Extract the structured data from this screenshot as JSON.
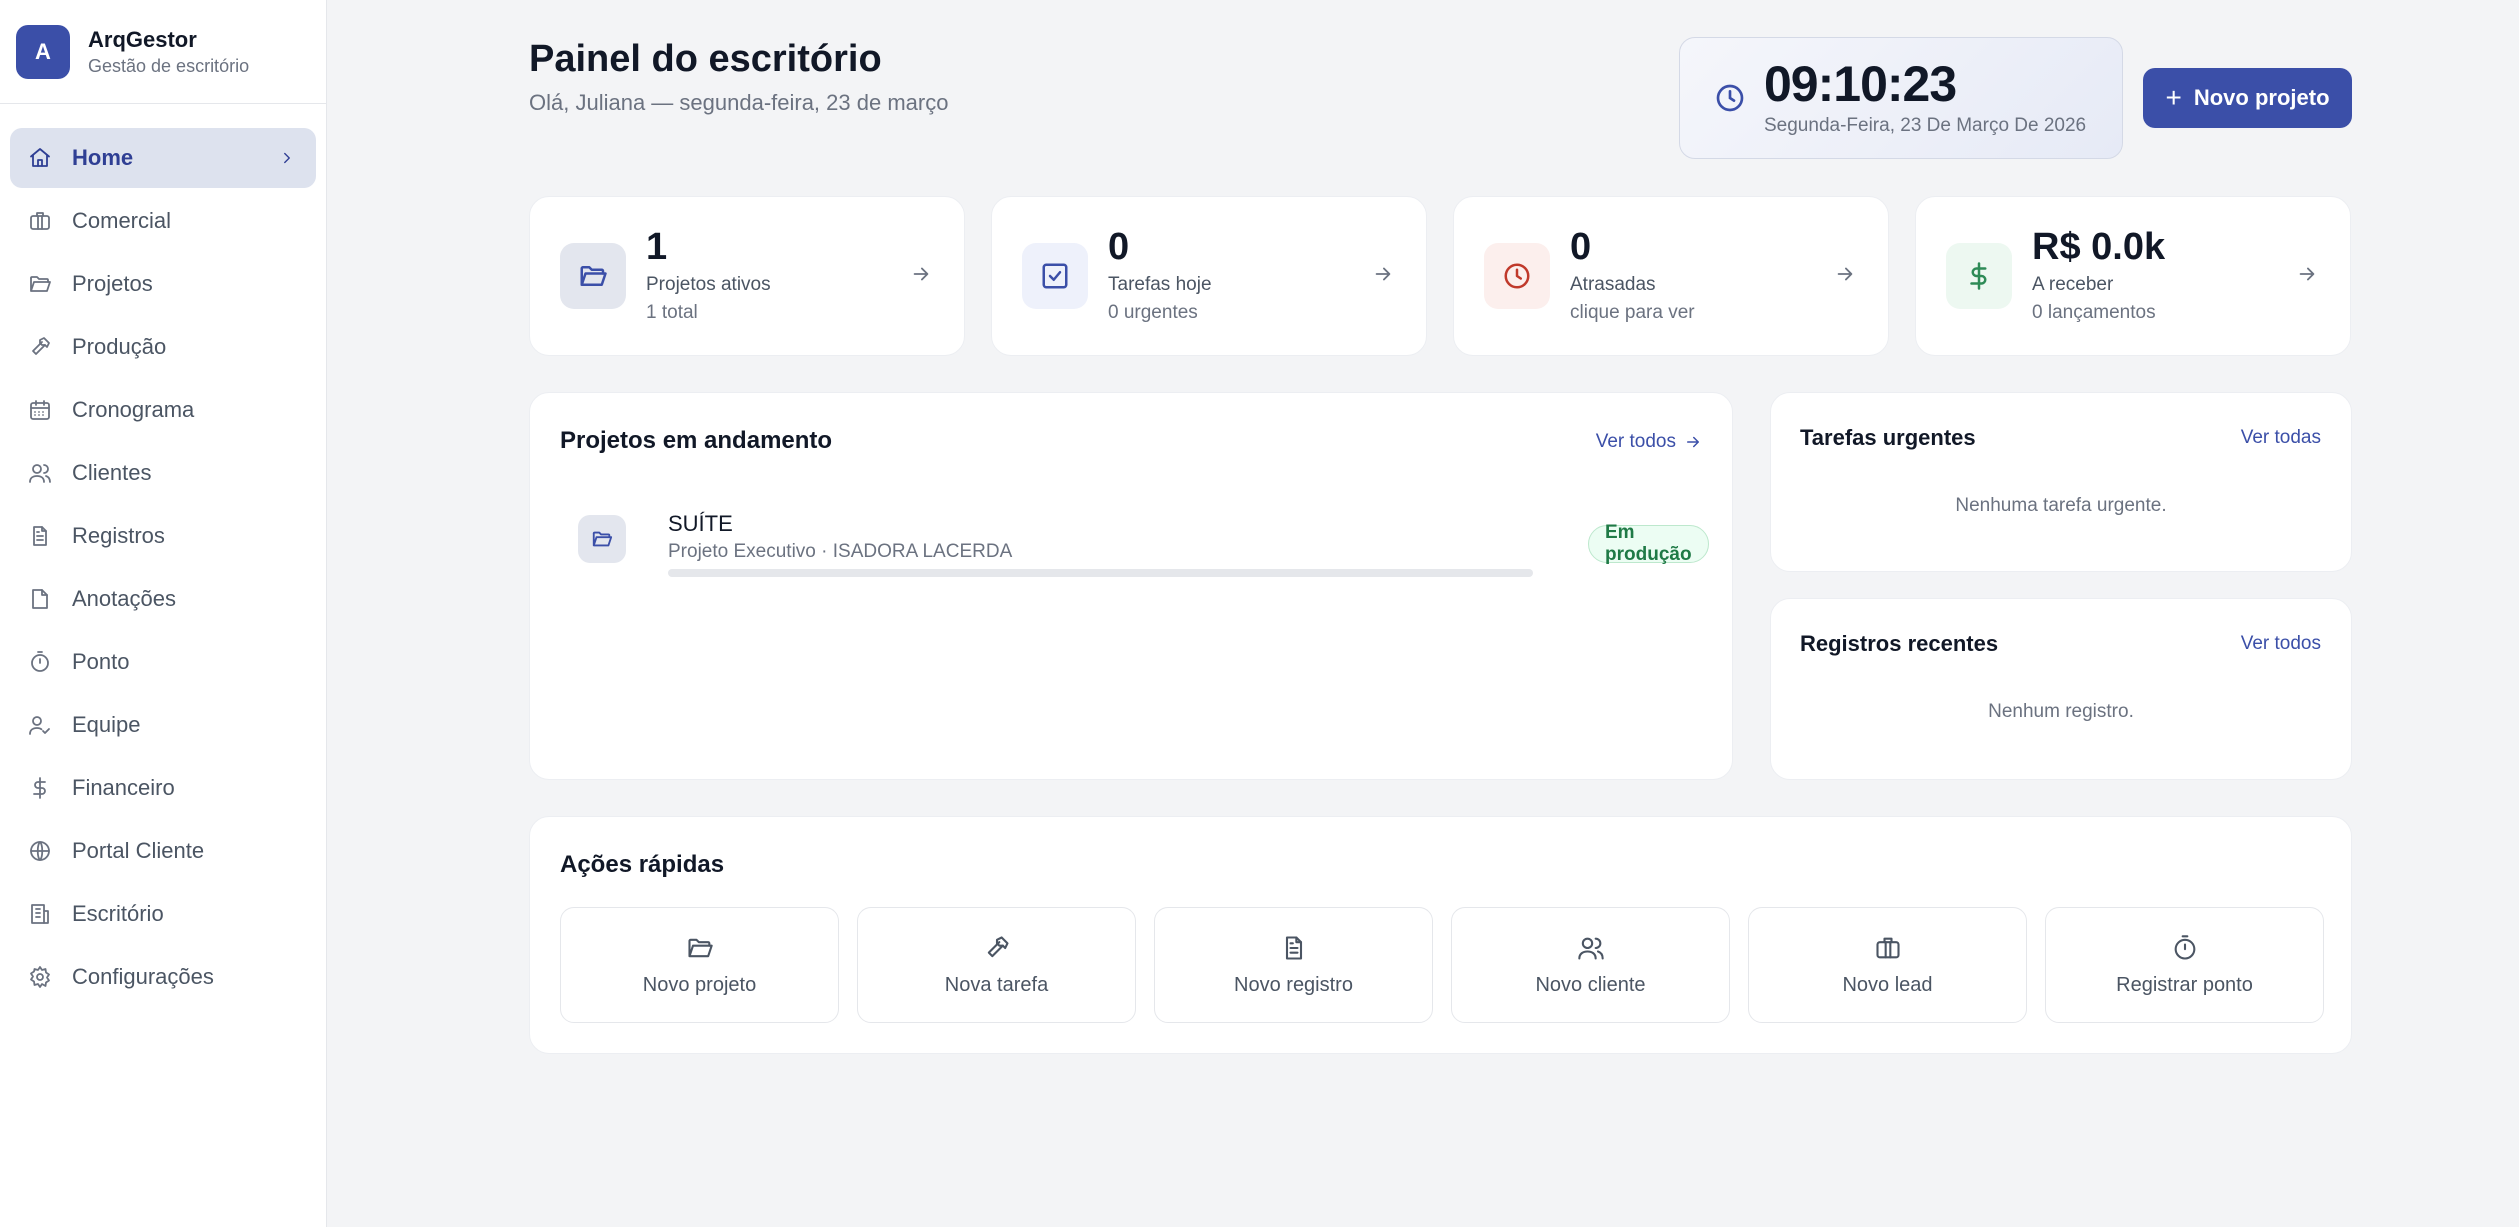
{
  "brand": {
    "initial": "A",
    "name": "ArqGestor",
    "subtitle": "Gestão de escritório"
  },
  "sidebar": {
    "items": [
      {
        "label": "Home",
        "icon": "home-icon",
        "active": true
      },
      {
        "label": "Comercial",
        "icon": "briefcase-icon"
      },
      {
        "label": "Projetos",
        "icon": "folder-icon"
      },
      {
        "label": "Produção",
        "icon": "hammer-icon"
      },
      {
        "label": "Cronograma",
        "icon": "calendar-icon"
      },
      {
        "label": "Clientes",
        "icon": "users-icon"
      },
      {
        "label": "Registros",
        "icon": "file-text-icon"
      },
      {
        "label": "Anotações",
        "icon": "note-icon"
      },
      {
        "label": "Ponto",
        "icon": "timer-icon"
      },
      {
        "label": "Equipe",
        "icon": "user-check-icon"
      },
      {
        "label": "Financeiro",
        "icon": "dollar-icon"
      },
      {
        "label": "Portal Cliente",
        "icon": "globe-icon"
      },
      {
        "label": "Escritório",
        "icon": "building-icon"
      },
      {
        "label": "Configurações",
        "icon": "gear-icon"
      }
    ]
  },
  "header": {
    "title": "Painel do escritório",
    "subtitle": "Olá, Juliana — segunda-feira, 23 de março",
    "clock_time": "09:10:23",
    "clock_date": "Segunda-Feira, 23 De Março De 2026",
    "new_project_label": "Novo projeto"
  },
  "stats": [
    {
      "value": "1",
      "label": "Projetos ativos",
      "sub": "1 total",
      "icon": "folder-icon",
      "color": "#3b4fa8",
      "bg": "#e3e6ee"
    },
    {
      "value": "0",
      "label": "Tarefas hoje",
      "sub": "0 urgentes",
      "icon": "checkbox-icon",
      "color": "#3b4fa8",
      "bg": "#eef1fb"
    },
    {
      "value": "0",
      "label": "Atrasadas",
      "sub": "clique para ver",
      "icon": "clock-icon",
      "color": "#c0392b",
      "bg": "#fcefed"
    },
    {
      "value": "R$ 0.0k",
      "label": "A receber",
      "sub": "0 lançamentos",
      "icon": "dollar-icon",
      "color": "#2e8b57",
      "bg": "#edf8f1"
    }
  ],
  "projects_panel": {
    "title": "Projetos em andamento",
    "link": "Ver todos",
    "projects": [
      {
        "name": "SUÍTE",
        "meta": "Projeto Executivo · ISADORA LACERDA",
        "status": "Em produção",
        "progress": 0
      }
    ]
  },
  "urgent_panel": {
    "title": "Tarefas urgentes",
    "link": "Ver todas",
    "empty": "Nenhuma tarefa urgente."
  },
  "records_panel": {
    "title": "Registros recentes",
    "link": "Ver todos",
    "empty": "Nenhum registro."
  },
  "quick_actions": {
    "title": "Ações rápidas",
    "items": [
      {
        "label": "Novo projeto",
        "icon": "folder-icon"
      },
      {
        "label": "Nova tarefa",
        "icon": "hammer-icon"
      },
      {
        "label": "Novo registro",
        "icon": "file-text-icon"
      },
      {
        "label": "Novo cliente",
        "icon": "users-icon"
      },
      {
        "label": "Novo lead",
        "icon": "briefcase-icon"
      },
      {
        "label": "Registrar ponto",
        "icon": "timer-icon"
      }
    ]
  },
  "colors": {
    "primary": "#3b4fa8",
    "active_nav_bg": "#dde2ee",
    "success": "#1f7a46"
  }
}
